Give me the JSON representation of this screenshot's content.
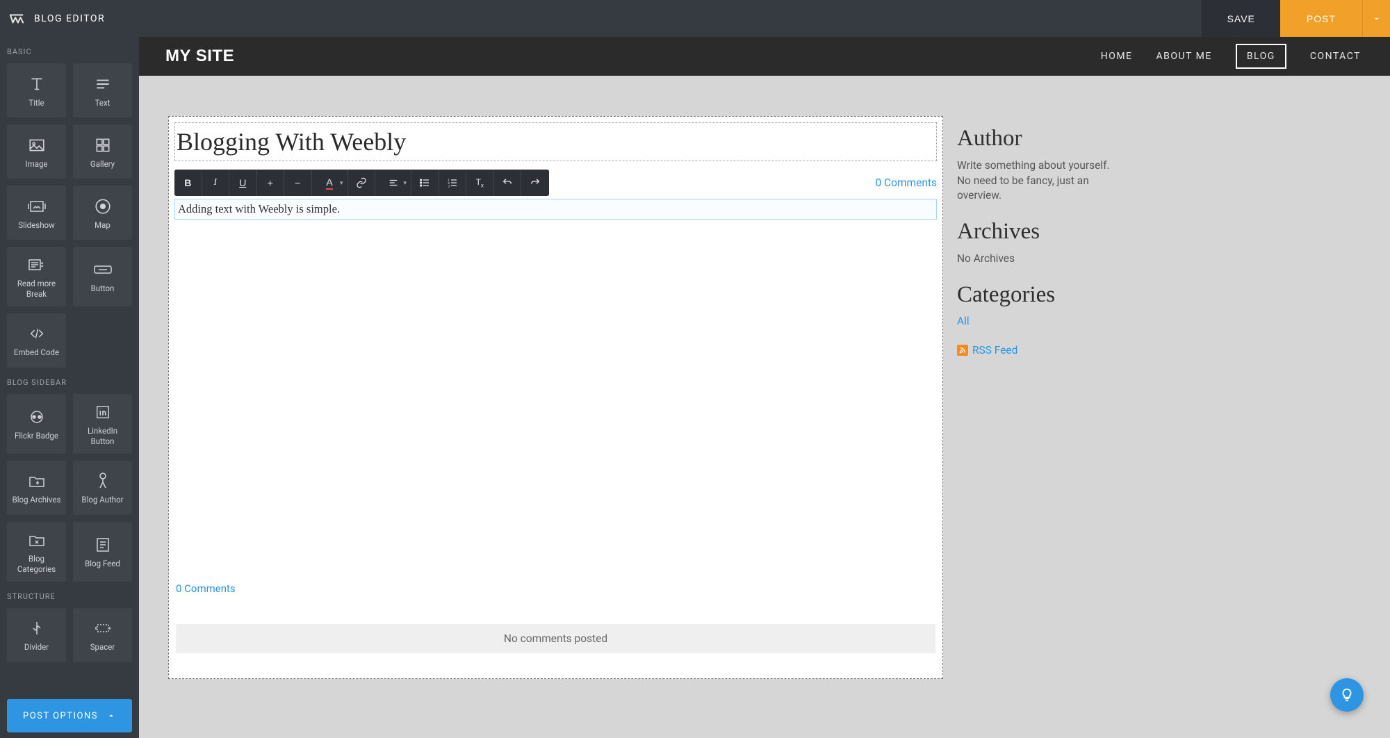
{
  "app": {
    "title": "BLOG EDITOR"
  },
  "topbar": {
    "save": "SAVE",
    "post": "POST"
  },
  "sidebar": {
    "sections": {
      "basic": {
        "label": "BASIC"
      },
      "blog_sidebar": {
        "label": "BLOG SIDEBAR"
      },
      "structure": {
        "label": "STRUCTURE"
      }
    },
    "basic_items": [
      {
        "label": "Title"
      },
      {
        "label": "Text"
      },
      {
        "label": "Image"
      },
      {
        "label": "Gallery"
      },
      {
        "label": "Slideshow"
      },
      {
        "label": "Map"
      },
      {
        "label": "Read more Break"
      },
      {
        "label": "Button"
      },
      {
        "label": "Embed Code"
      }
    ],
    "blog_sidebar_items": [
      {
        "label": "Flickr Badge"
      },
      {
        "label": "LinkedIn Button"
      },
      {
        "label": "Blog Archives"
      },
      {
        "label": "Blog Author"
      },
      {
        "label": "Blog Categories"
      },
      {
        "label": "Blog Feed"
      }
    ],
    "structure_items": [
      {
        "label": "Divider"
      },
      {
        "label": "Spacer"
      }
    ],
    "post_options": "POST OPTIONS"
  },
  "site": {
    "title": "MY SITE",
    "nav": [
      {
        "label": "HOME"
      },
      {
        "label": "ABOUT ME"
      },
      {
        "label": "BLOG",
        "active": true
      },
      {
        "label": "CONTACT"
      }
    ]
  },
  "post": {
    "title": "Blogging With Weebly",
    "comments_top": "0 Comments",
    "body_text": "Adding text with Weebly is simple.",
    "comments_bottom": "0 Comments",
    "no_comments": "No comments posted"
  },
  "aside": {
    "author_h": "Author",
    "author_p": "Write something about yourself. No need to be fancy, just an overview.",
    "archives_h": "Archives",
    "archives_p": "No Archives",
    "categories_h": "Categories",
    "categories_link": "All",
    "rss": "RSS Feed"
  },
  "toolbar_icons": [
    "bold",
    "italic",
    "underline",
    "increase",
    "decrease",
    "text-color",
    "link",
    "align",
    "bullet-list",
    "number-list",
    "clear-format",
    "undo",
    "redo"
  ]
}
